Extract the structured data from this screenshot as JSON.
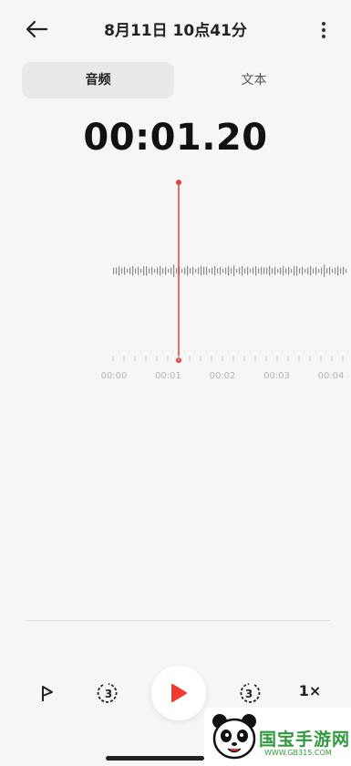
{
  "header": {
    "title": "8月11日 10点41分"
  },
  "tabs": [
    {
      "label": "音频",
      "selected": true
    },
    {
      "label": "文本",
      "selected": false
    }
  ],
  "timer": "00:01.20",
  "timeline": {
    "ticks": [
      "00:00",
      "00:01",
      "00:02",
      "00:03",
      "00:04"
    ],
    "playhead_color": "#e0443a"
  },
  "controls": {
    "speed": "1×",
    "skip_seconds": "3"
  },
  "watermark": {
    "brand": "国宝手游网",
    "url": "WWW.GB315.COM"
  },
  "colors": {
    "accent": "#ef3b2f",
    "background": "#f6f6f6"
  }
}
